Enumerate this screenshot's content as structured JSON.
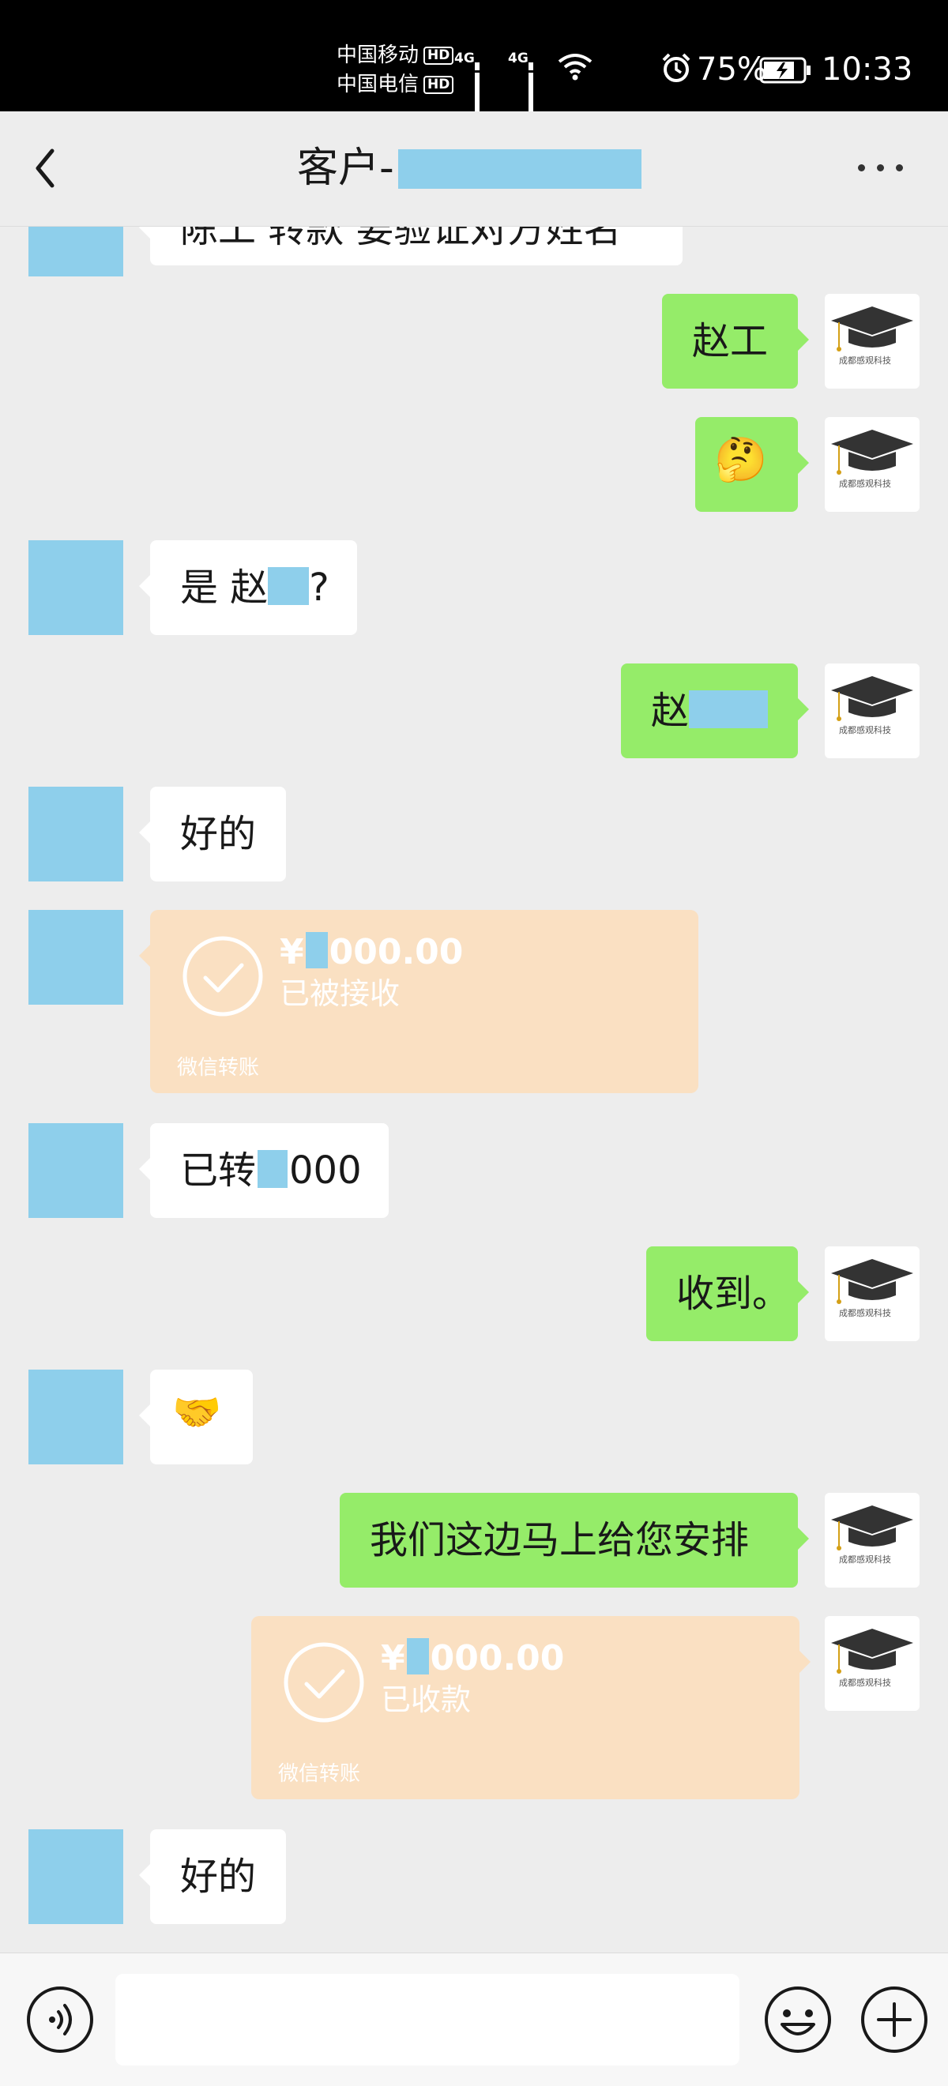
{
  "status_bar": {
    "carrier1": "中国移动",
    "carrier2": "中国电信",
    "hd": "HD",
    "network": "4G",
    "battery": "75%",
    "time": "10:33"
  },
  "header": {
    "title": "客户-"
  },
  "messages": {
    "partial_top": "陈工 转款 要验证对方姓名",
    "m1": "赵工",
    "m3_a": "是 赵",
    "m3_b": "?",
    "m4": "赵",
    "m5": "好的",
    "t1": {
      "currency": "¥",
      "amount": "000.00",
      "status": "已被接收",
      "label": "微信转账"
    },
    "m7_a": "已转",
    "m7_b": "000",
    "m8": "收到。",
    "m10": "我们这边马上给您安排",
    "t2": {
      "currency": "¥",
      "amount": "000.00",
      "status": "已收款",
      "label": "微信转账"
    },
    "m12": "好的"
  },
  "avatar_me": {
    "caption": "成都感观科技"
  },
  "icons": {
    "back": "back-arrow-icon",
    "more": "more-icon",
    "voice": "voice-icon",
    "emoji": "emoji-icon",
    "plus": "plus-icon"
  },
  "colors": {
    "my_bubble": "#95ec69",
    "other_bubble": "#ffffff",
    "transfer": "#fae0c2",
    "redaction": "#8ecfeb"
  }
}
